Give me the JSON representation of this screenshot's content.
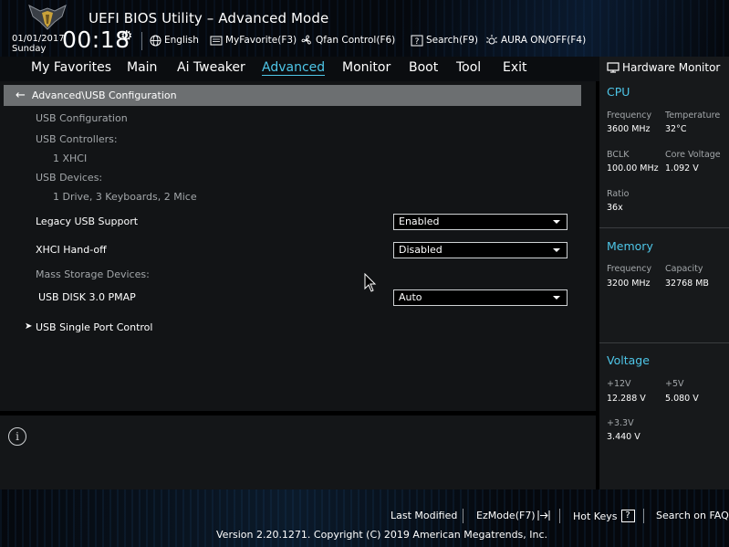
{
  "header": {
    "title": "UEFI BIOS Utility – Advanced Mode",
    "date": "01/01/2017",
    "day": "Sunday",
    "time": "00:18",
    "toolbar": {
      "language": "English",
      "myfavorite": "MyFavorite(F3)",
      "qfan": "Qfan Control(F6)",
      "search": "Search(F9)",
      "aura": "AURA ON/OFF(F4)"
    }
  },
  "nav": {
    "tabs": [
      {
        "label": "My Favorites"
      },
      {
        "label": "Main"
      },
      {
        "label": "Ai Tweaker"
      },
      {
        "label": "Advanced",
        "active": true
      },
      {
        "label": "Monitor"
      },
      {
        "label": "Boot"
      },
      {
        "label": "Tool"
      },
      {
        "label": "Exit"
      }
    ]
  },
  "main": {
    "breadcrumb": "Advanced\\USB Configuration",
    "usb_configuration": "USB Configuration",
    "usb_controllers_label": "USB Controllers:",
    "usb_controllers_value": "1 XHCI",
    "usb_devices_label": "USB Devices:",
    "usb_devices_value": "1 Drive, 3 Keyboards, 2 Mice",
    "legacy_usb_label": "Legacy USB Support",
    "legacy_usb_value": "Enabled",
    "xhci_label": "XHCI Hand-off",
    "xhci_value": "Disabled",
    "mass_storage_label": "Mass Storage Devices:",
    "usb_disk_label": "USB DISK 3.0 PMAP",
    "usb_disk_value": "Auto",
    "single_port_label": "USB Single Port Control"
  },
  "hardware_monitor": {
    "title": "Hardware Monitor",
    "cpu": {
      "heading": "CPU",
      "frequency_label": "Frequency",
      "frequency_value": "3600 MHz",
      "temperature_label": "Temperature",
      "temperature_value": "32°C",
      "bclk_label": "BCLK",
      "bclk_value": "100.00 MHz",
      "core_voltage_label": "Core Voltage",
      "core_voltage_value": "1.092 V",
      "ratio_label": "Ratio",
      "ratio_value": "36x"
    },
    "memory": {
      "heading": "Memory",
      "frequency_label": "Frequency",
      "frequency_value": "3200 MHz",
      "capacity_label": "Capacity",
      "capacity_value": "32768 MB"
    },
    "voltage": {
      "heading": "Voltage",
      "v12_label": "+12V",
      "v12_value": "12.288 V",
      "v5_label": "+5V",
      "v5_value": "5.080 V",
      "v33_label": "+3.3V",
      "v33_value": "3.440 V"
    }
  },
  "footer": {
    "last_modified": "Last Modified",
    "ezmode": "EzMode(F7)",
    "hot_keys": "Hot Keys",
    "hot_keys_key": "?",
    "search_faq": "Search on FAQ",
    "version": "Version 2.20.1271. Copyright (C) 2019 American Megatrends, Inc."
  },
  "colors": {
    "accent": "#4ec6e8",
    "breadcrumb_bg": "#6c6f71",
    "panel_bg": "#121416"
  }
}
